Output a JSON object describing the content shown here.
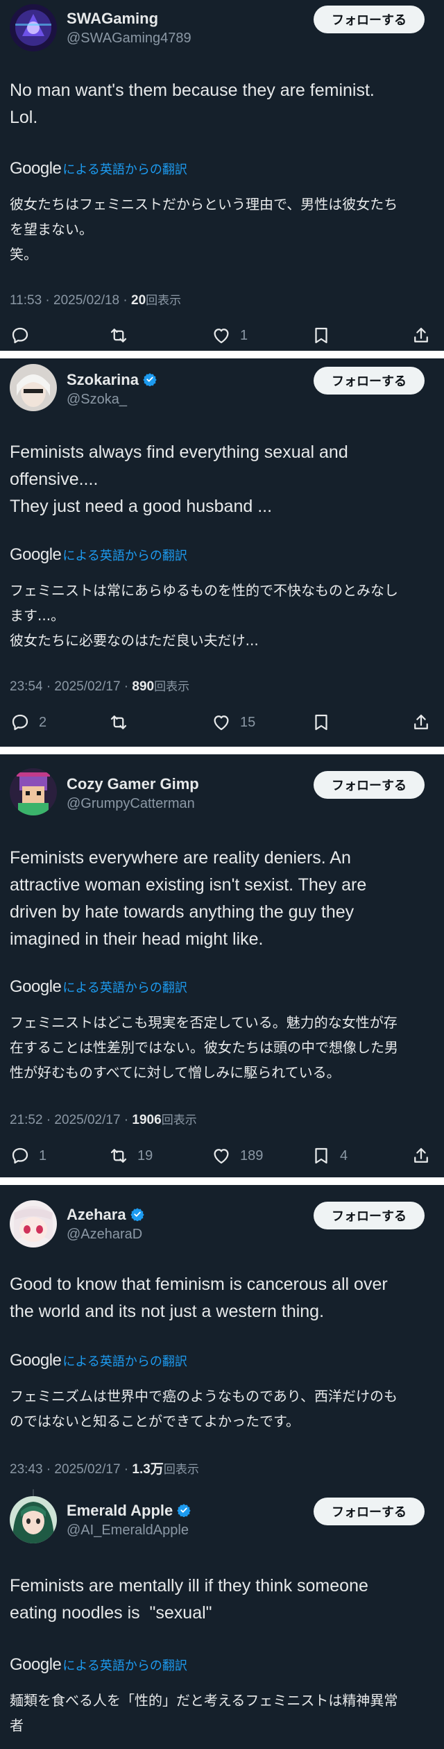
{
  "ui": {
    "follow_label": "フォローする",
    "translate_logo": "Google",
    "translate_link": "による英語からの翻訳",
    "views_suffix": "回表示",
    "colors": {
      "background": "#15202b",
      "link": "#1d9bf0",
      "verified": "#1d9bf0",
      "muted": "#8b98a5",
      "separator": "#ffffff"
    }
  },
  "tweets": [
    {
      "name": "SWAGaming",
      "verified": false,
      "handle": "@SWAGaming4789",
      "avatar_icon": "purple-glitch-avatar",
      "text": "No man want's them because they are feminist.\nLol.",
      "translation": "彼女たちはフェミニストだからという理由で、男性は彼女たち\nを望まない。\n笑。",
      "time": "11:53 · 2025/02/18 · ",
      "views": "20",
      "reply_count": "",
      "retweet_count": "",
      "like_count": "1",
      "bookmark_count": ""
    },
    {
      "name": "Szokarina",
      "verified": true,
      "handle": "@Szoka_",
      "avatar_icon": "white-hair-character-avatar",
      "text": "Feminists always find everything sexual and\noffensive....\nThey just need a good husband ...",
      "translation": "フェミニストは常にあらゆるものを性的で不快なものとみなし\nます...。\n彼女たちに必要なのはただ良い夫だけ...",
      "time": "23:54 · 2025/02/17 · ",
      "views": "890",
      "reply_count": "2",
      "retweet_count": "",
      "like_count": "15",
      "bookmark_count": ""
    },
    {
      "name": "Cozy Gamer Gimp",
      "verified": false,
      "handle": "@GrumpyCatterman",
      "avatar_icon": "pixel-character-avatar",
      "text": "Feminists everywhere are reality deniers. An\nattractive woman existing isn't sexist. They are\ndriven by hate towards anything the guy they\nimagined in their head might like.",
      "translation": "フェミニストはどこも現実を否定している。魅力的な女性が存\n在することは性差別ではない。彼女たちは頭の中で想像した男\n性が好むものすべてに対して憎しみに駆られている。",
      "time": "21:52 · 2025/02/17 · ",
      "views": "1906",
      "reply_count": "1",
      "retweet_count": "19",
      "like_count": "189",
      "bookmark_count": "4"
    },
    {
      "name": "Azehara",
      "verified": true,
      "handle": "@AzeharaD",
      "avatar_icon": "anime-girl-avatar",
      "text": "Good to know that feminism is cancerous all over\nthe world and its not just a western thing.",
      "translation": "フェミニズムは世界中で癌のようなものであり、西洋だけのも\nのではないと知ることができてよかったです。",
      "time": "23:43 · 2025/02/17 · ",
      "views": "1.3万",
      "reply_count": "",
      "retweet_count": "",
      "like_count": "",
      "bookmark_count": ""
    },
    {
      "name": "Emerald Apple",
      "verified": true,
      "handle": "@AI_EmeraldApple",
      "avatar_icon": "green-hair-girl-avatar",
      "text": "Feminists are mentally ill if they think someone\neating noodles is  \"sexual\"",
      "translation": "麺類を食べる人を「性的」だと考えるフェミニストは精神異常\n者",
      "time": "",
      "views": "",
      "reply_count": "",
      "retweet_count": "",
      "like_count": "",
      "bookmark_count": ""
    }
  ]
}
